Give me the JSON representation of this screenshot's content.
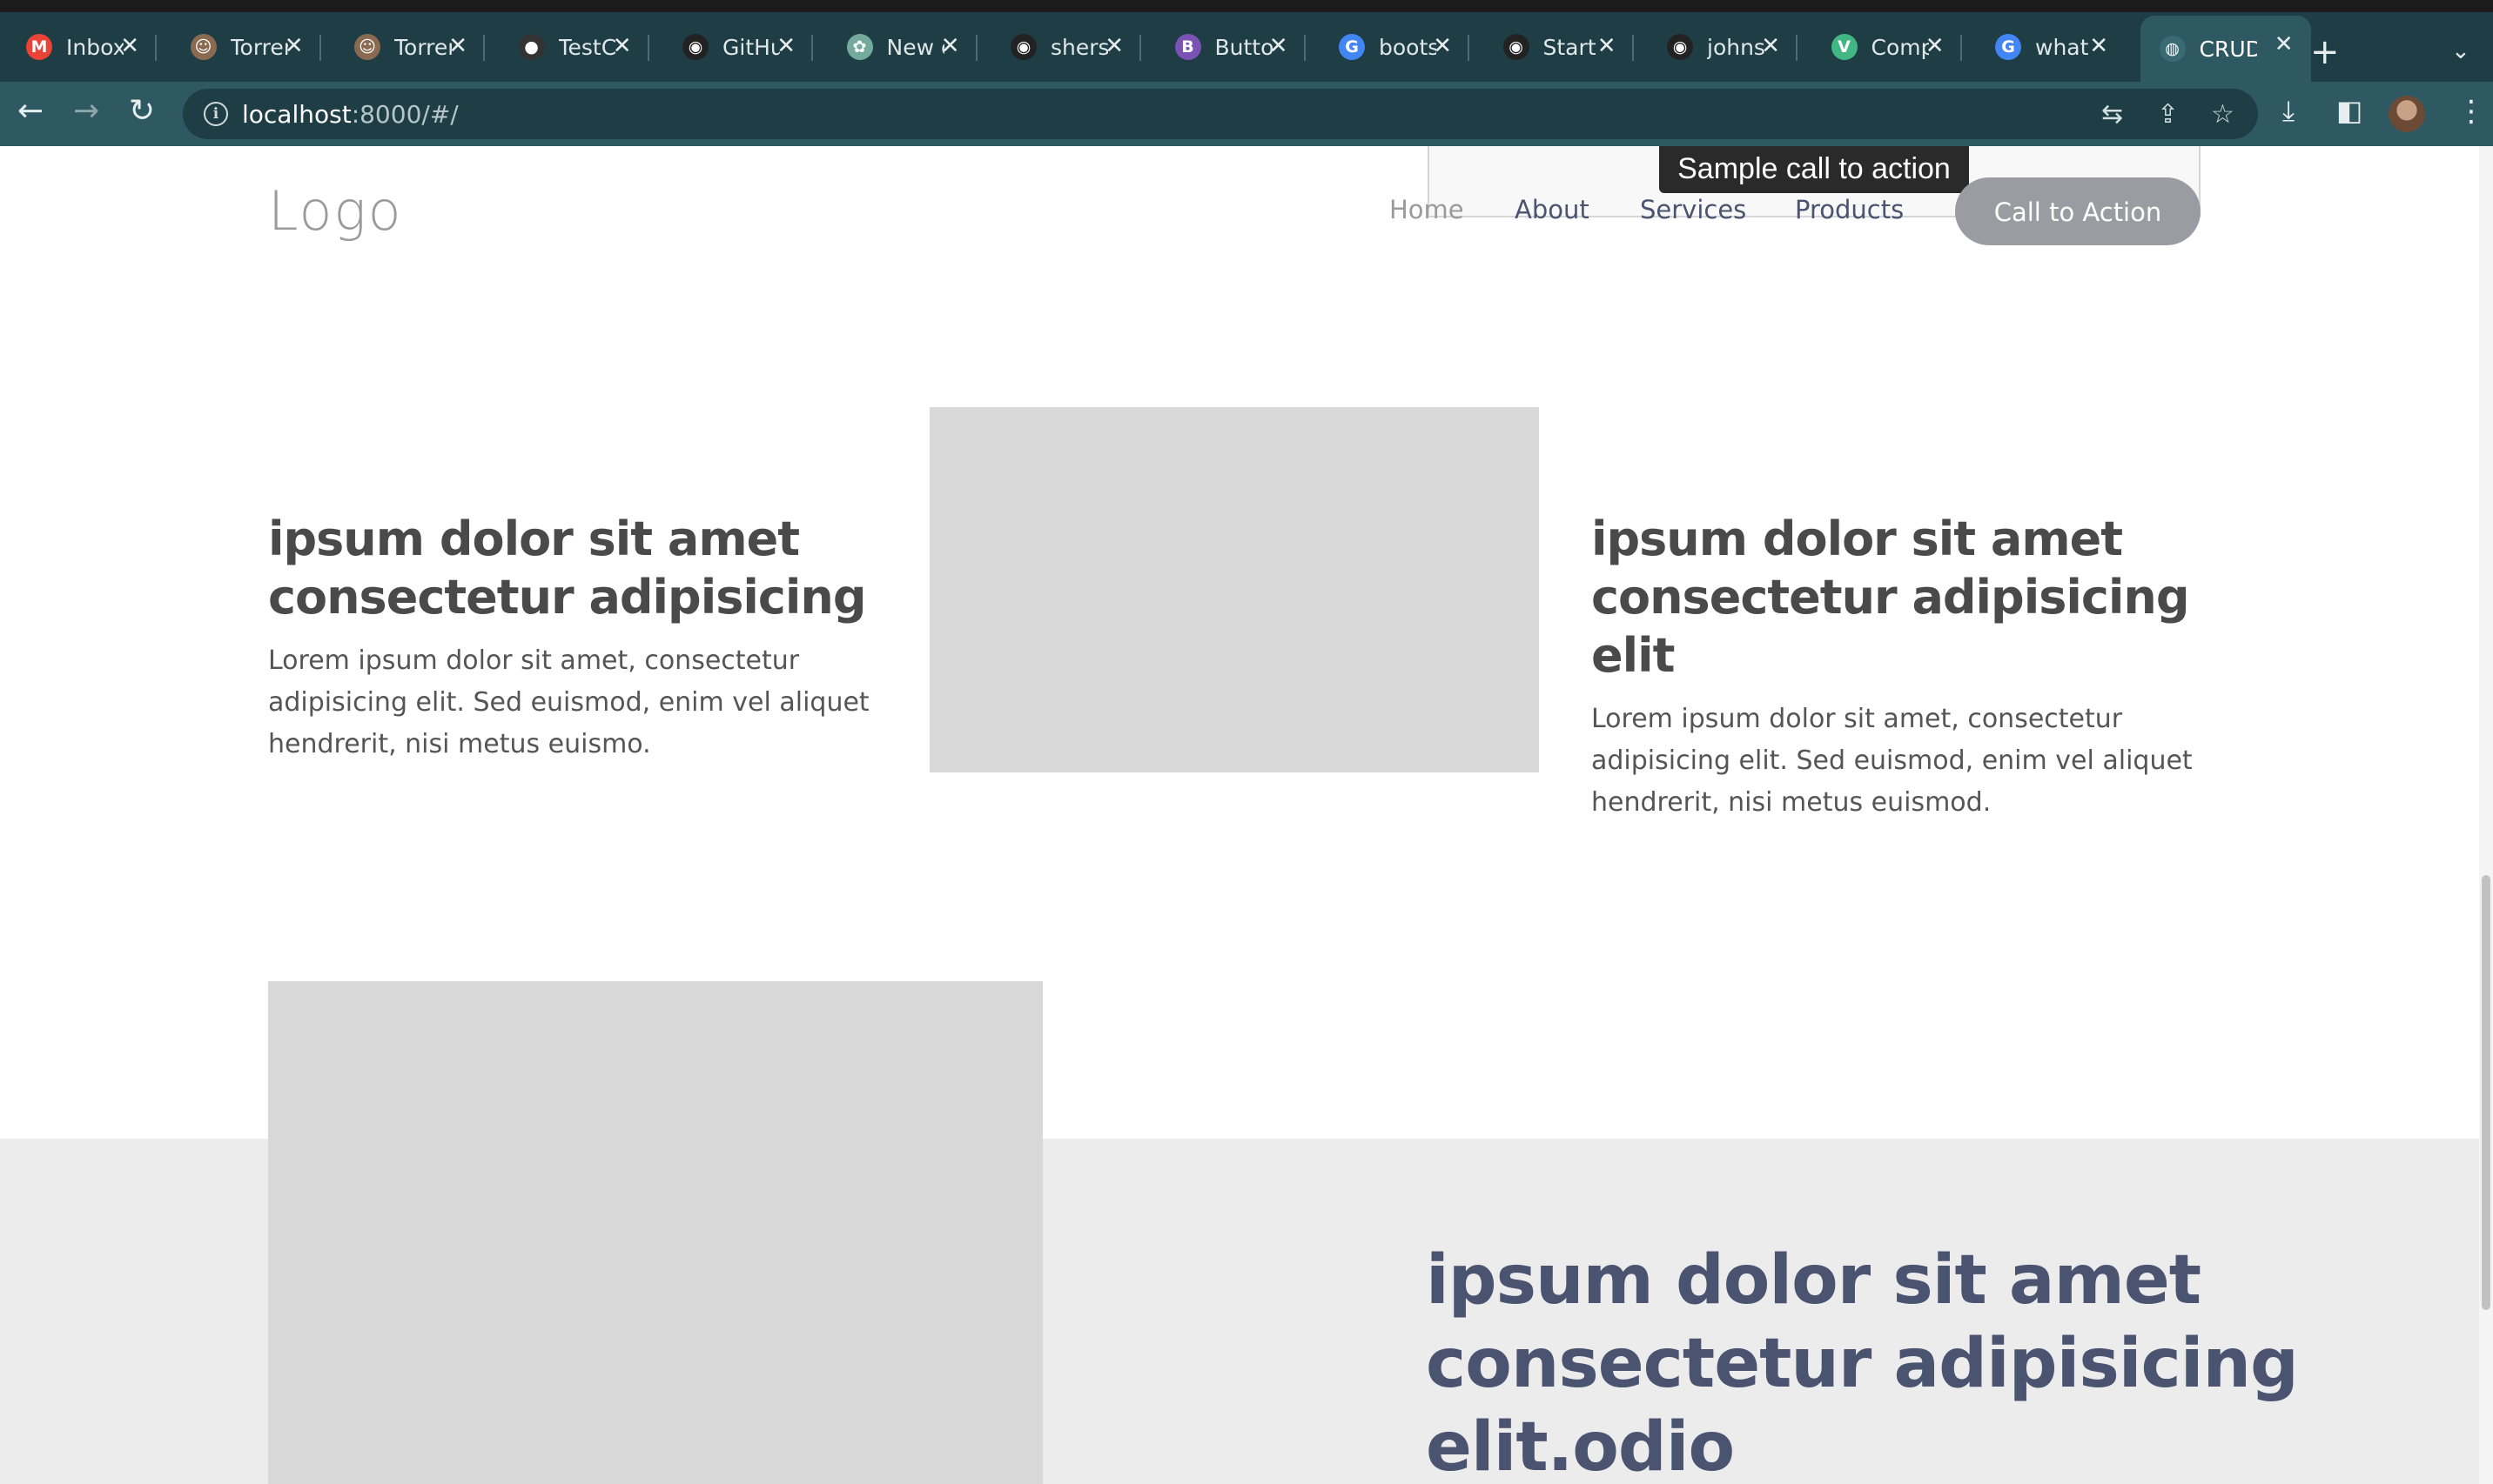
{
  "browser": {
    "tabs": [
      {
        "title": "Inbox",
        "icon": "gmail-icon",
        "color": "#ea4335",
        "glyph": "M"
      },
      {
        "title": "Torrents",
        "icon": "portrait-icon",
        "color": "#8a6a50",
        "glyph": "☺"
      },
      {
        "title": "Torrents",
        "icon": "portrait-icon",
        "color": "#8a6a50",
        "glyph": "☺"
      },
      {
        "title": "TestCafe",
        "icon": "bot-icon",
        "color": "#333333",
        "glyph": "●"
      },
      {
        "title": "GitHub",
        "icon": "github-icon",
        "color": "#222222",
        "glyph": "◉"
      },
      {
        "title": "New chat",
        "icon": "openai-icon",
        "color": "#74aa9c",
        "glyph": "✿"
      },
      {
        "title": "sherstinsky",
        "icon": "github-icon",
        "color": "#222222",
        "glyph": "◉"
      },
      {
        "title": "Buttons",
        "icon": "bootstrap-icon",
        "color": "#7952b3",
        "glyph": "B"
      },
      {
        "title": "bootstrap",
        "icon": "google-icon",
        "color": "#4285f4",
        "glyph": "G"
      },
      {
        "title": "Start",
        "icon": "github-icon",
        "color": "#222222",
        "glyph": "◉"
      },
      {
        "title": "johnsmith",
        "icon": "github-icon",
        "color": "#222222",
        "glyph": "◉"
      },
      {
        "title": "Components",
        "icon": "vue-icon",
        "color": "#41b883",
        "glyph": "V"
      },
      {
        "title": "what is",
        "icon": "google-icon",
        "color": "#4285f4",
        "glyph": "G"
      },
      {
        "title": "CRUD",
        "icon": "globe-icon",
        "color": "#3a6b74",
        "glyph": "◍",
        "active": true
      }
    ],
    "url_host": "localhost",
    "url_rest": ":8000/#/"
  },
  "page": {
    "tooltip": "Sample call to action",
    "logo": "Logo",
    "nav": {
      "home": "Home",
      "about": "About",
      "services": "Services",
      "products": "Products",
      "cta": "Call to Action"
    },
    "features": [
      {
        "title": "ipsum dolor sit amet consectetur adipisicing",
        "text": "Lorem ipsum dolor sit amet, consectetur adipisicing elit. Sed euismod, enim vel aliquet hendrerit, nisi metus euismo."
      },
      {
        "title": "ipsum dolor sit amet consectetur adipisicing elit",
        "text": "Lorem ipsum dolor sit amet, consectetur adipisicing elit. Sed euismod, enim vel aliquet hendrerit, nisi metus euismod."
      }
    ],
    "section2_title": "ipsum dolor sit amet consectetur adipisicing elit.odio"
  },
  "colors": {
    "chrome_bg": "#1e3d44",
    "toolbar_bg": "#2f5962",
    "heading": "#4a4a4a",
    "accent_heading": "#4a5470",
    "cta_bg": "#9b9ba2",
    "placeholder": "#d8d8d8",
    "band": "#ececec"
  }
}
